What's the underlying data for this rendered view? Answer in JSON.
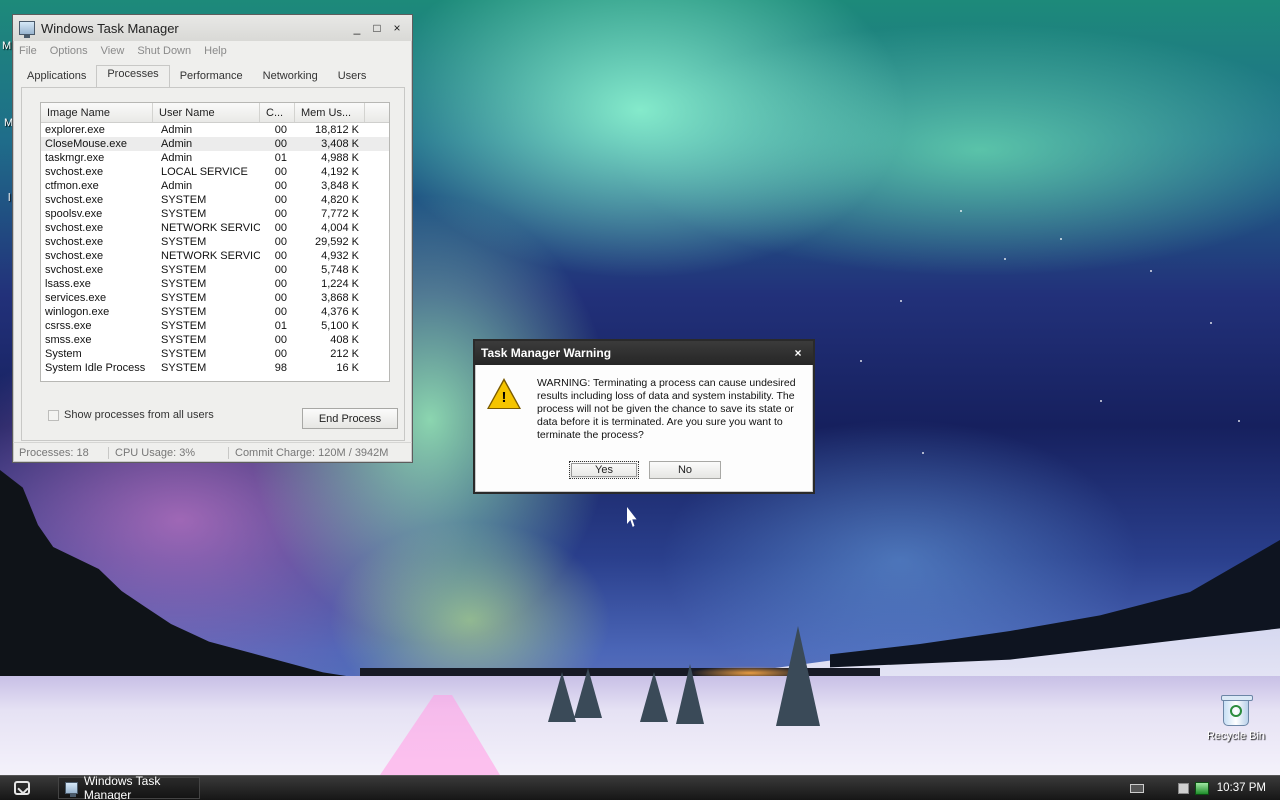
{
  "desktop": {
    "recycle_bin_label": "Recycle Bin",
    "edge_fragments": [
      "M",
      "M",
      "l"
    ]
  },
  "taskmgr": {
    "title": "Windows Task Manager",
    "menu": [
      "File",
      "Options",
      "View",
      "Shut Down",
      "Help"
    ],
    "tabs": [
      "Applications",
      "Processes",
      "Performance",
      "Networking",
      "Users"
    ],
    "active_tab": "Processes",
    "columns": [
      "Image Name",
      "User Name",
      "C...",
      "Mem Us..."
    ],
    "processes": [
      {
        "name": "explorer.exe",
        "user": "Admin",
        "cpu": "00",
        "mem": "18,812 K"
      },
      {
        "name": "CloseMouse.exe",
        "user": "Admin",
        "cpu": "00",
        "mem": "3,408 K"
      },
      {
        "name": "taskmgr.exe",
        "user": "Admin",
        "cpu": "01",
        "mem": "4,988 K"
      },
      {
        "name": "svchost.exe",
        "user": "LOCAL SERVICE",
        "cpu": "00",
        "mem": "4,192 K"
      },
      {
        "name": "ctfmon.exe",
        "user": "Admin",
        "cpu": "00",
        "mem": "3,848 K"
      },
      {
        "name": "svchost.exe",
        "user": "SYSTEM",
        "cpu": "00",
        "mem": "4,820 K"
      },
      {
        "name": "spoolsv.exe",
        "user": "SYSTEM",
        "cpu": "00",
        "mem": "7,772 K"
      },
      {
        "name": "svchost.exe",
        "user": "NETWORK SERVICE",
        "cpu": "00",
        "mem": "4,004 K"
      },
      {
        "name": "svchost.exe",
        "user": "SYSTEM",
        "cpu": "00",
        "mem": "29,592 K"
      },
      {
        "name": "svchost.exe",
        "user": "NETWORK SERVICE",
        "cpu": "00",
        "mem": "4,932 K"
      },
      {
        "name": "svchost.exe",
        "user": "SYSTEM",
        "cpu": "00",
        "mem": "5,748 K"
      },
      {
        "name": "lsass.exe",
        "user": "SYSTEM",
        "cpu": "00",
        "mem": "1,224 K"
      },
      {
        "name": "services.exe",
        "user": "SYSTEM",
        "cpu": "00",
        "mem": "3,868 K"
      },
      {
        "name": "winlogon.exe",
        "user": "SYSTEM",
        "cpu": "00",
        "mem": "4,376 K"
      },
      {
        "name": "csrss.exe",
        "user": "SYSTEM",
        "cpu": "01",
        "mem": "5,100 K"
      },
      {
        "name": "smss.exe",
        "user": "SYSTEM",
        "cpu": "00",
        "mem": "408 K"
      },
      {
        "name": "System",
        "user": "SYSTEM",
        "cpu": "00",
        "mem": "212 K"
      },
      {
        "name": "System Idle Process",
        "user": "SYSTEM",
        "cpu": "98",
        "mem": "16 K"
      }
    ],
    "selected_row_index": 1,
    "show_all_label": "Show processes from all users",
    "show_all_checked": false,
    "end_process_label": "End Process",
    "status": {
      "processes": "Processes: 18",
      "cpu": "CPU Usage: 3%",
      "commit": "Commit Charge: 120M / 3942M"
    }
  },
  "warning": {
    "title": "Task Manager Warning",
    "message_lines": [
      "WARNING: Terminating a process can cause undesired",
      "results including loss of data and system instability. The",
      "process will not be given the chance to save its state or",
      "data before it is terminated.  Are you sure you want to",
      "terminate the process?"
    ],
    "yes_label": "Yes",
    "no_label": "No",
    "icon": "warning-triangle-icon"
  },
  "taskbar": {
    "task_label": "Windows Task Manager",
    "clock": "10:37 PM"
  },
  "icons": {
    "minimize": "_",
    "maximize": "□",
    "close": "×"
  }
}
